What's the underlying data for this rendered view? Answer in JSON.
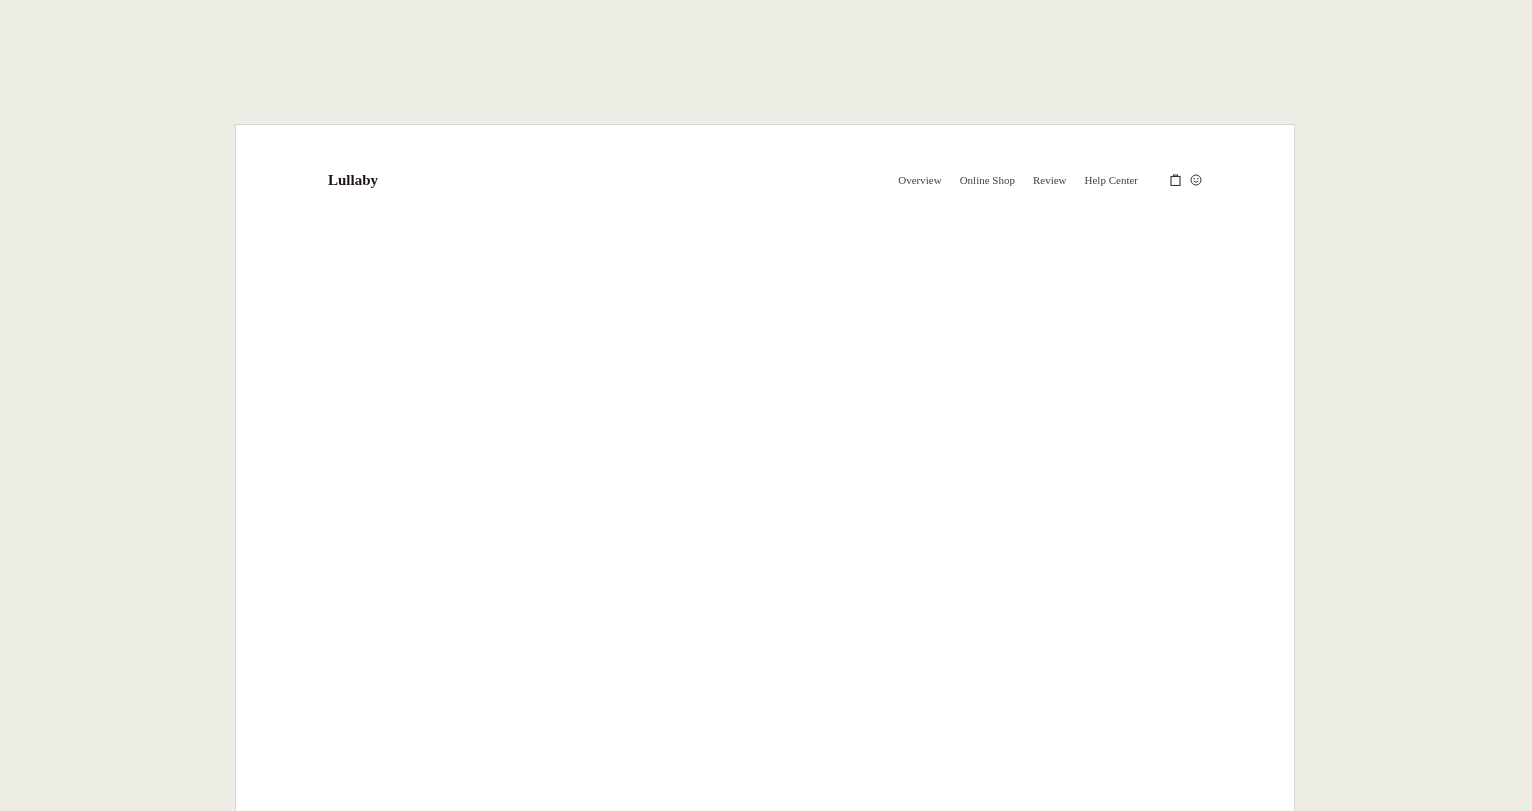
{
  "brand": "Lullaby",
  "nav": [
    "Overview",
    "Online Shop",
    "Review",
    "Help Center"
  ]
}
